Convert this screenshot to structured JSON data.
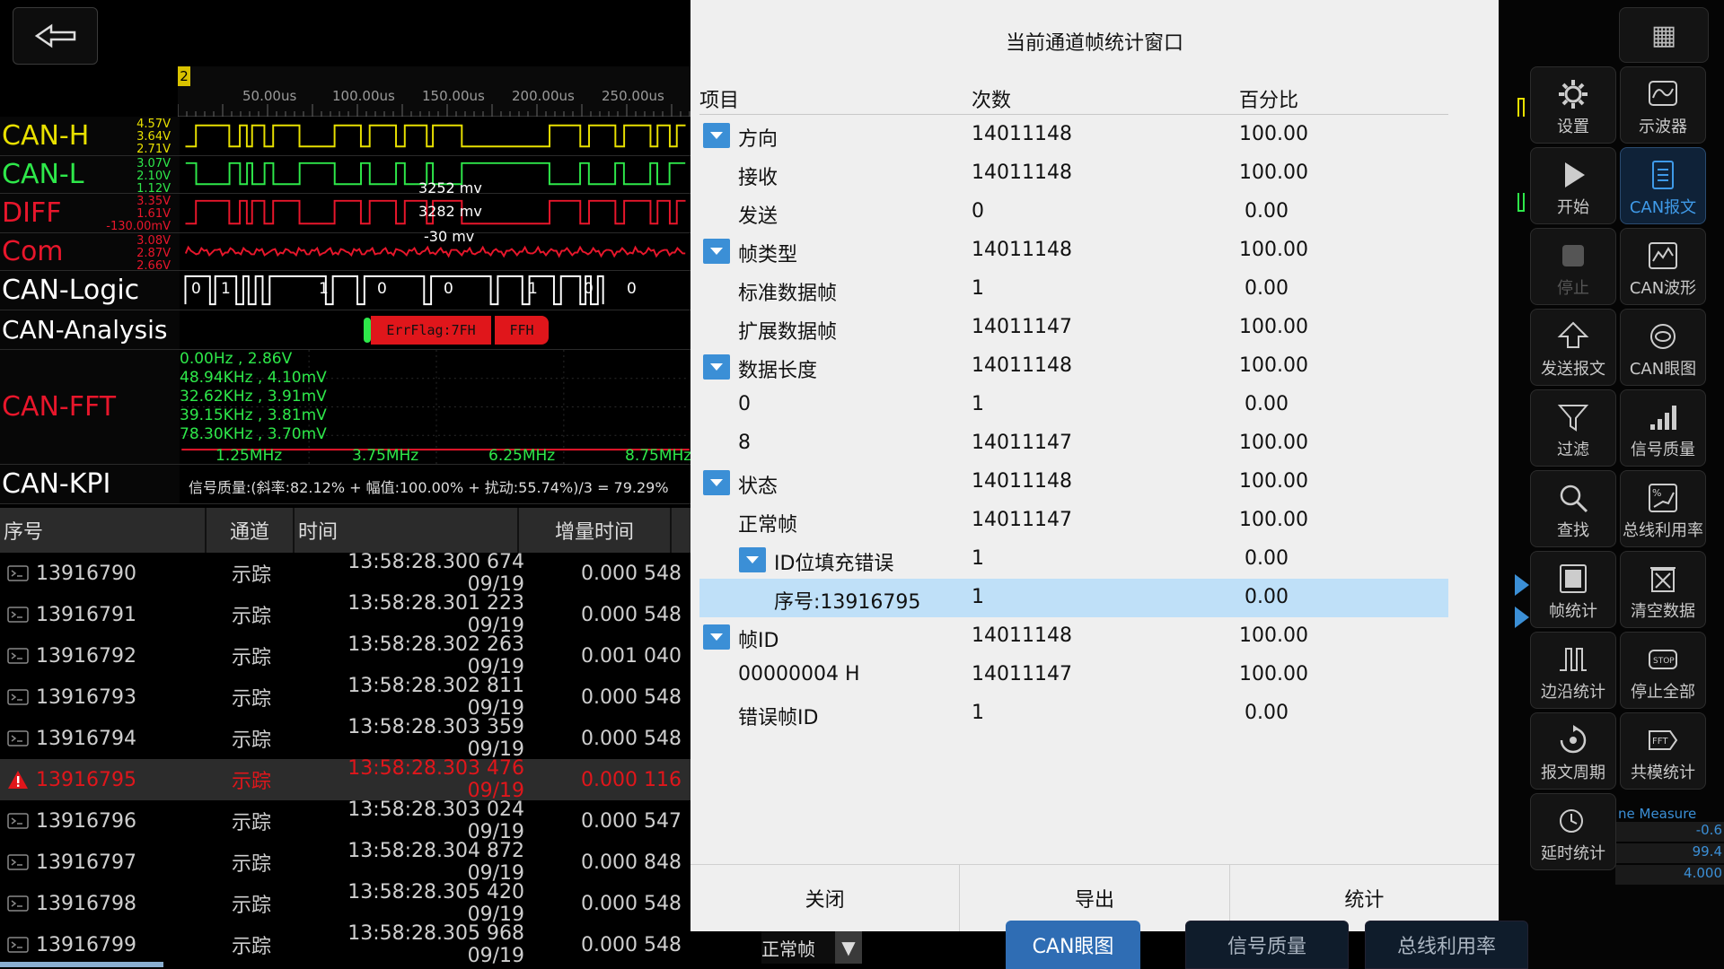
{
  "ruler": {
    "marker": "2",
    "ticks": [
      "50.00us",
      "100.00us",
      "150.00us",
      "200.00us",
      "250.00us"
    ]
  },
  "channels": [
    {
      "label": "CAN-H",
      "color": "#e8e000",
      "scale": [
        "4.57V",
        "3.64V",
        "2.71V"
      ]
    },
    {
      "label": "CAN-L",
      "color": "#2ee84a",
      "scale": [
        "3.07V",
        "2.10V",
        "1.12V"
      ]
    },
    {
      "label": "DIFF",
      "color": "#e8162b",
      "scale": [
        "3.35V",
        "1.61V",
        "-130.00mV"
      ]
    },
    {
      "label": "Com",
      "color": "#e8162b",
      "scale": [
        "3.08V",
        "2.87V",
        "2.66V"
      ]
    },
    {
      "label": "CAN-Logic",
      "color": "#ffffff"
    },
    {
      "label": "CAN-Analysis",
      "color": "#ffffff"
    },
    {
      "label": "CAN-FFT",
      "color": "#e8162b"
    },
    {
      "label": "CAN-KPI",
      "color": "#ffffff"
    }
  ],
  "diff_annotations": [
    "3252 mv",
    "3282 mv",
    "-30 mv"
  ],
  "logic_bits": [
    "0",
    "1",
    "1",
    "0",
    "0",
    "1",
    "0",
    "0"
  ],
  "analysis": {
    "err_flag": "ErrFlag:7FH",
    "ffh": "FFH"
  },
  "fft": {
    "peaks": [
      "0.00Hz , 2.86V",
      "48.94KHz , 4.10mV",
      "32.62KHz , 3.91mV",
      "39.15KHz , 3.81mV",
      "78.30KHz , 3.70mV"
    ],
    "freqs": [
      "1.25MHz",
      "3.75MHz",
      "6.25MHz",
      "8.75MHz"
    ]
  },
  "kpi_text": "信号质量:(斜率:82.12% + 幅值:100.00% + 扰动:55.74%)/3 = 79.29%",
  "table": {
    "headers": [
      "序号",
      "通道",
      "时间",
      "增量时间"
    ],
    "rows": [
      {
        "seq": "13916790",
        "ch": "示踪",
        "time": "13:58:28.300 674 09/19",
        "delta": "0.000 548",
        "err": false
      },
      {
        "seq": "13916791",
        "ch": "示踪",
        "time": "13:58:28.301 223 09/19",
        "delta": "0.000 548",
        "err": false
      },
      {
        "seq": "13916792",
        "ch": "示踪",
        "time": "13:58:28.302 263 09/19",
        "delta": "0.001 040",
        "err": false
      },
      {
        "seq": "13916793",
        "ch": "示踪",
        "time": "13:58:28.302 811 09/19",
        "delta": "0.000 548",
        "err": false
      },
      {
        "seq": "13916794",
        "ch": "示踪",
        "time": "13:58:28.303 359 09/19",
        "delta": "0.000 548",
        "err": false
      },
      {
        "seq": "13916795",
        "ch": "示踪",
        "time": "13:58:28.303 476 09/19",
        "delta": "0.000 116",
        "err": true
      },
      {
        "seq": "13916796",
        "ch": "示踪",
        "time": "13:58:28.303 024 09/19",
        "delta": "0.000 547",
        "err": false
      },
      {
        "seq": "13916797",
        "ch": "示踪",
        "time": "13:58:28.304 872 09/19",
        "delta": "0.000 848",
        "err": false
      },
      {
        "seq": "13916798",
        "ch": "示踪",
        "time": "13:58:28.305 420 09/19",
        "delta": "0.000 548",
        "err": false
      },
      {
        "seq": "13916799",
        "ch": "示踪",
        "time": "13:58:28.305 968 09/19",
        "delta": "0.000 548",
        "err": false
      }
    ]
  },
  "dialog": {
    "title": "当前通道帧统计窗口",
    "headers": [
      "项目",
      "次数",
      "百分比"
    ],
    "rows": [
      {
        "name": "方向",
        "count": "14011148",
        "pct": "100.00",
        "level": 0,
        "expander": true
      },
      {
        "name": "接收",
        "count": "14011148",
        "pct": "100.00",
        "level": 1
      },
      {
        "name": "发送",
        "count": "0",
        "pct": "0.00",
        "level": 1
      },
      {
        "name": "帧类型",
        "count": "14011148",
        "pct": "100.00",
        "level": 0,
        "expander": true
      },
      {
        "name": "标准数据帧",
        "count": "1",
        "pct": "0.00",
        "level": 1
      },
      {
        "name": "扩展数据帧",
        "count": "14011147",
        "pct": "100.00",
        "level": 1
      },
      {
        "name": "数据长度",
        "count": "14011148",
        "pct": "100.00",
        "level": 0,
        "expander": true
      },
      {
        "name": "0",
        "count": "1",
        "pct": "0.00",
        "level": 1
      },
      {
        "name": "8",
        "count": "14011147",
        "pct": "100.00",
        "level": 1
      },
      {
        "name": "状态",
        "count": "14011148",
        "pct": "100.00",
        "level": 0,
        "expander": true
      },
      {
        "name": "正常帧",
        "count": "14011147",
        "pct": "100.00",
        "level": 1
      },
      {
        "name": "ID位填充错误",
        "count": "1",
        "pct": "0.00",
        "level": 1,
        "expander": true
      },
      {
        "name": "序号:13916795",
        "count": "1",
        "pct": "0.00",
        "level": 2,
        "selected": true
      },
      {
        "name": "帧ID",
        "count": "14011148",
        "pct": "100.00",
        "level": 0,
        "expander": true
      },
      {
        "name": "00000004 H",
        "count": "14011147",
        "pct": "100.00",
        "level": 1
      },
      {
        "name": "错误帧ID",
        "count": "1",
        "pct": "0.00",
        "level": 1
      }
    ],
    "buttons": [
      "关闭",
      "导出",
      "统计"
    ]
  },
  "filter": {
    "label": "正常帧"
  },
  "sidebar": [
    {
      "label": "设置",
      "icon": "gear-icon"
    },
    {
      "label": "示波器",
      "icon": "oscilloscope-icon"
    },
    {
      "label": "开始",
      "icon": "play-icon"
    },
    {
      "label": "CAN报文",
      "icon": "message-icon",
      "active": true
    },
    {
      "label": "停止",
      "icon": "stop-icon",
      "dim": true
    },
    {
      "label": "CAN波形",
      "icon": "waveform-icon"
    },
    {
      "label": "发送报文",
      "icon": "upload-icon"
    },
    {
      "label": "CAN眼图",
      "icon": "eye-icon"
    },
    {
      "label": "过滤",
      "icon": "filter-icon"
    },
    {
      "label": "信号质量",
      "icon": "signal-bars-icon"
    },
    {
      "label": "查找",
      "icon": "search-icon"
    },
    {
      "label": "总线利用率",
      "icon": "bus-load-icon"
    },
    {
      "label": "帧统计",
      "icon": "frame-stat-icon"
    },
    {
      "label": "清空数据",
      "icon": "clear-icon"
    },
    {
      "label": "边沿统计",
      "icon": "edge-icon"
    },
    {
      "label": "停止全部",
      "icon": "stop-all-icon"
    },
    {
      "label": "报文周期",
      "icon": "cycle-icon"
    },
    {
      "label": "共模统计",
      "icon": "fft-icon"
    },
    {
      "label": "延时统计",
      "icon": "delay-icon"
    }
  ],
  "menu_glyph": "▦",
  "stop_text": "STOP",
  "measure": {
    "title": "ne Measure",
    "values": [
      "-0.6",
      "99.4",
      "4.000"
    ]
  },
  "bottom_tabs": [
    "CAN眼图",
    "信号质量",
    "总线利用率"
  ],
  "colors": {
    "accent": "#3b8fd6",
    "error": "#e0161b"
  }
}
